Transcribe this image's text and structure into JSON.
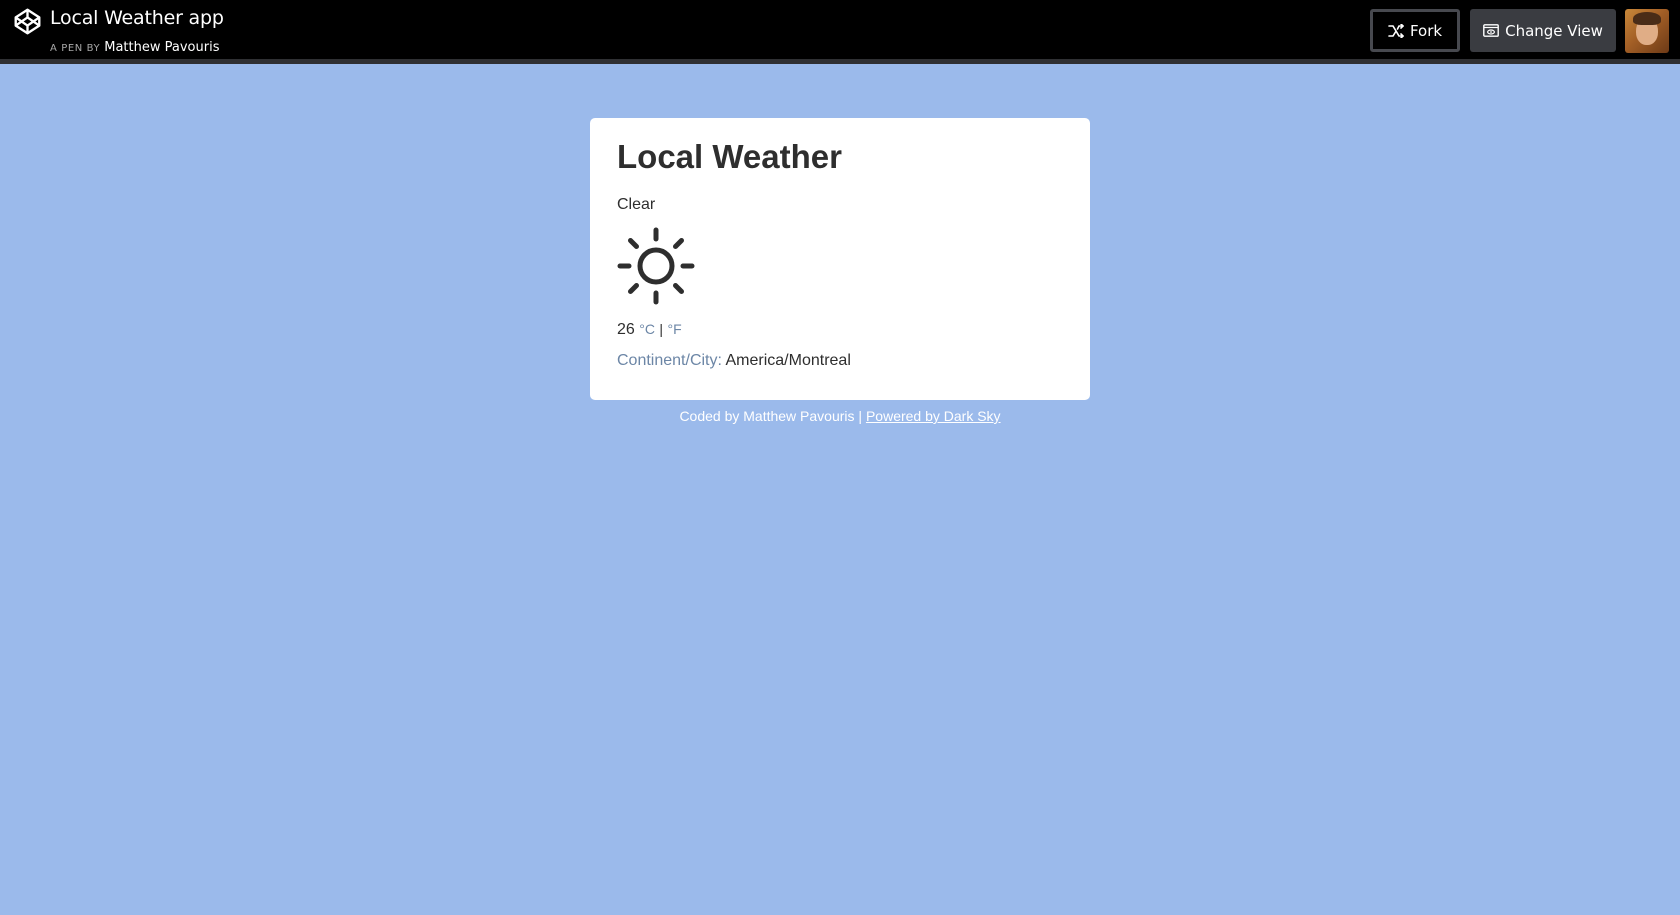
{
  "header": {
    "title": "Local Weather app",
    "byline_label": "A PEN BY",
    "author": "Matthew Pavouris",
    "fork_label": "Fork",
    "change_view_label": "Change View"
  },
  "weather": {
    "title": "Local Weather",
    "condition": "Clear",
    "icon": "sun-icon",
    "temperature": "26",
    "unit_c": "°C",
    "unit_sep": "|",
    "unit_f": "°F",
    "location_label": "Continent/City:",
    "location_value": "America/Montreal"
  },
  "footer": {
    "credit": "Coded by Matthew Pavouris |",
    "link_label": "Powered by Dark Sky"
  },
  "colors": {
    "background": "#9bbaeb",
    "topbar": "#000000",
    "card": "#ffffff",
    "muted_text": "#6c86a6"
  }
}
